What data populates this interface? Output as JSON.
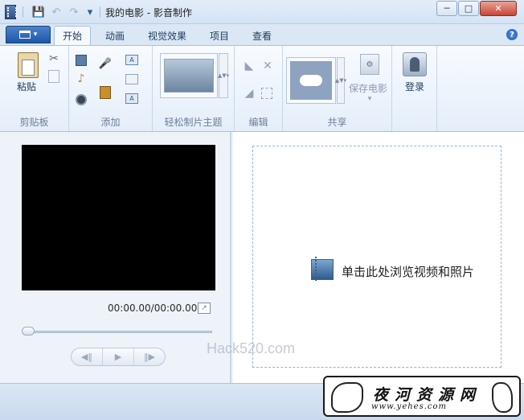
{
  "window": {
    "title": "我的电影 - 影音制作",
    "buttons": {
      "minimize": "─",
      "maximize": "□",
      "close": "✕"
    }
  },
  "quick_access": {
    "save": "💾",
    "undo": "↶",
    "redo": "↷",
    "customize": "▾"
  },
  "ribbon": {
    "app_menu_arrow": "▾",
    "tabs": [
      {
        "label": "开始",
        "active": true
      },
      {
        "label": "动画",
        "active": false
      },
      {
        "label": "视觉效果",
        "active": false
      },
      {
        "label": "项目",
        "active": false
      },
      {
        "label": "查看",
        "active": false
      }
    ],
    "help": "?",
    "groups": {
      "clipboard": {
        "label": "剪贴板",
        "paste": "粘贴"
      },
      "add": {
        "label": "添加"
      },
      "themes": {
        "label": "轻松制片主题"
      },
      "edit": {
        "label": "编辑"
      },
      "share": {
        "label": "共享",
        "save_movie": "保存电影"
      },
      "signin": {
        "label": "登录"
      }
    }
  },
  "preview": {
    "time": "00:00.00/00:00.00",
    "seek_position": 0,
    "controls": {
      "prev": "◀‖",
      "play": "▶",
      "next": "‖▶"
    }
  },
  "storyboard": {
    "prompt": "单击此处浏览视频和照片"
  },
  "overlay": {
    "watermark": "Hack520.com",
    "logo_text": "夜河资源网",
    "logo_url": "www.yehes.com"
  },
  "colors": {
    "ribbon_bg": "#e4eef9",
    "accent": "#1c57a8",
    "video_bg": "#000000",
    "dropzone_border": "#8fb4dc"
  }
}
